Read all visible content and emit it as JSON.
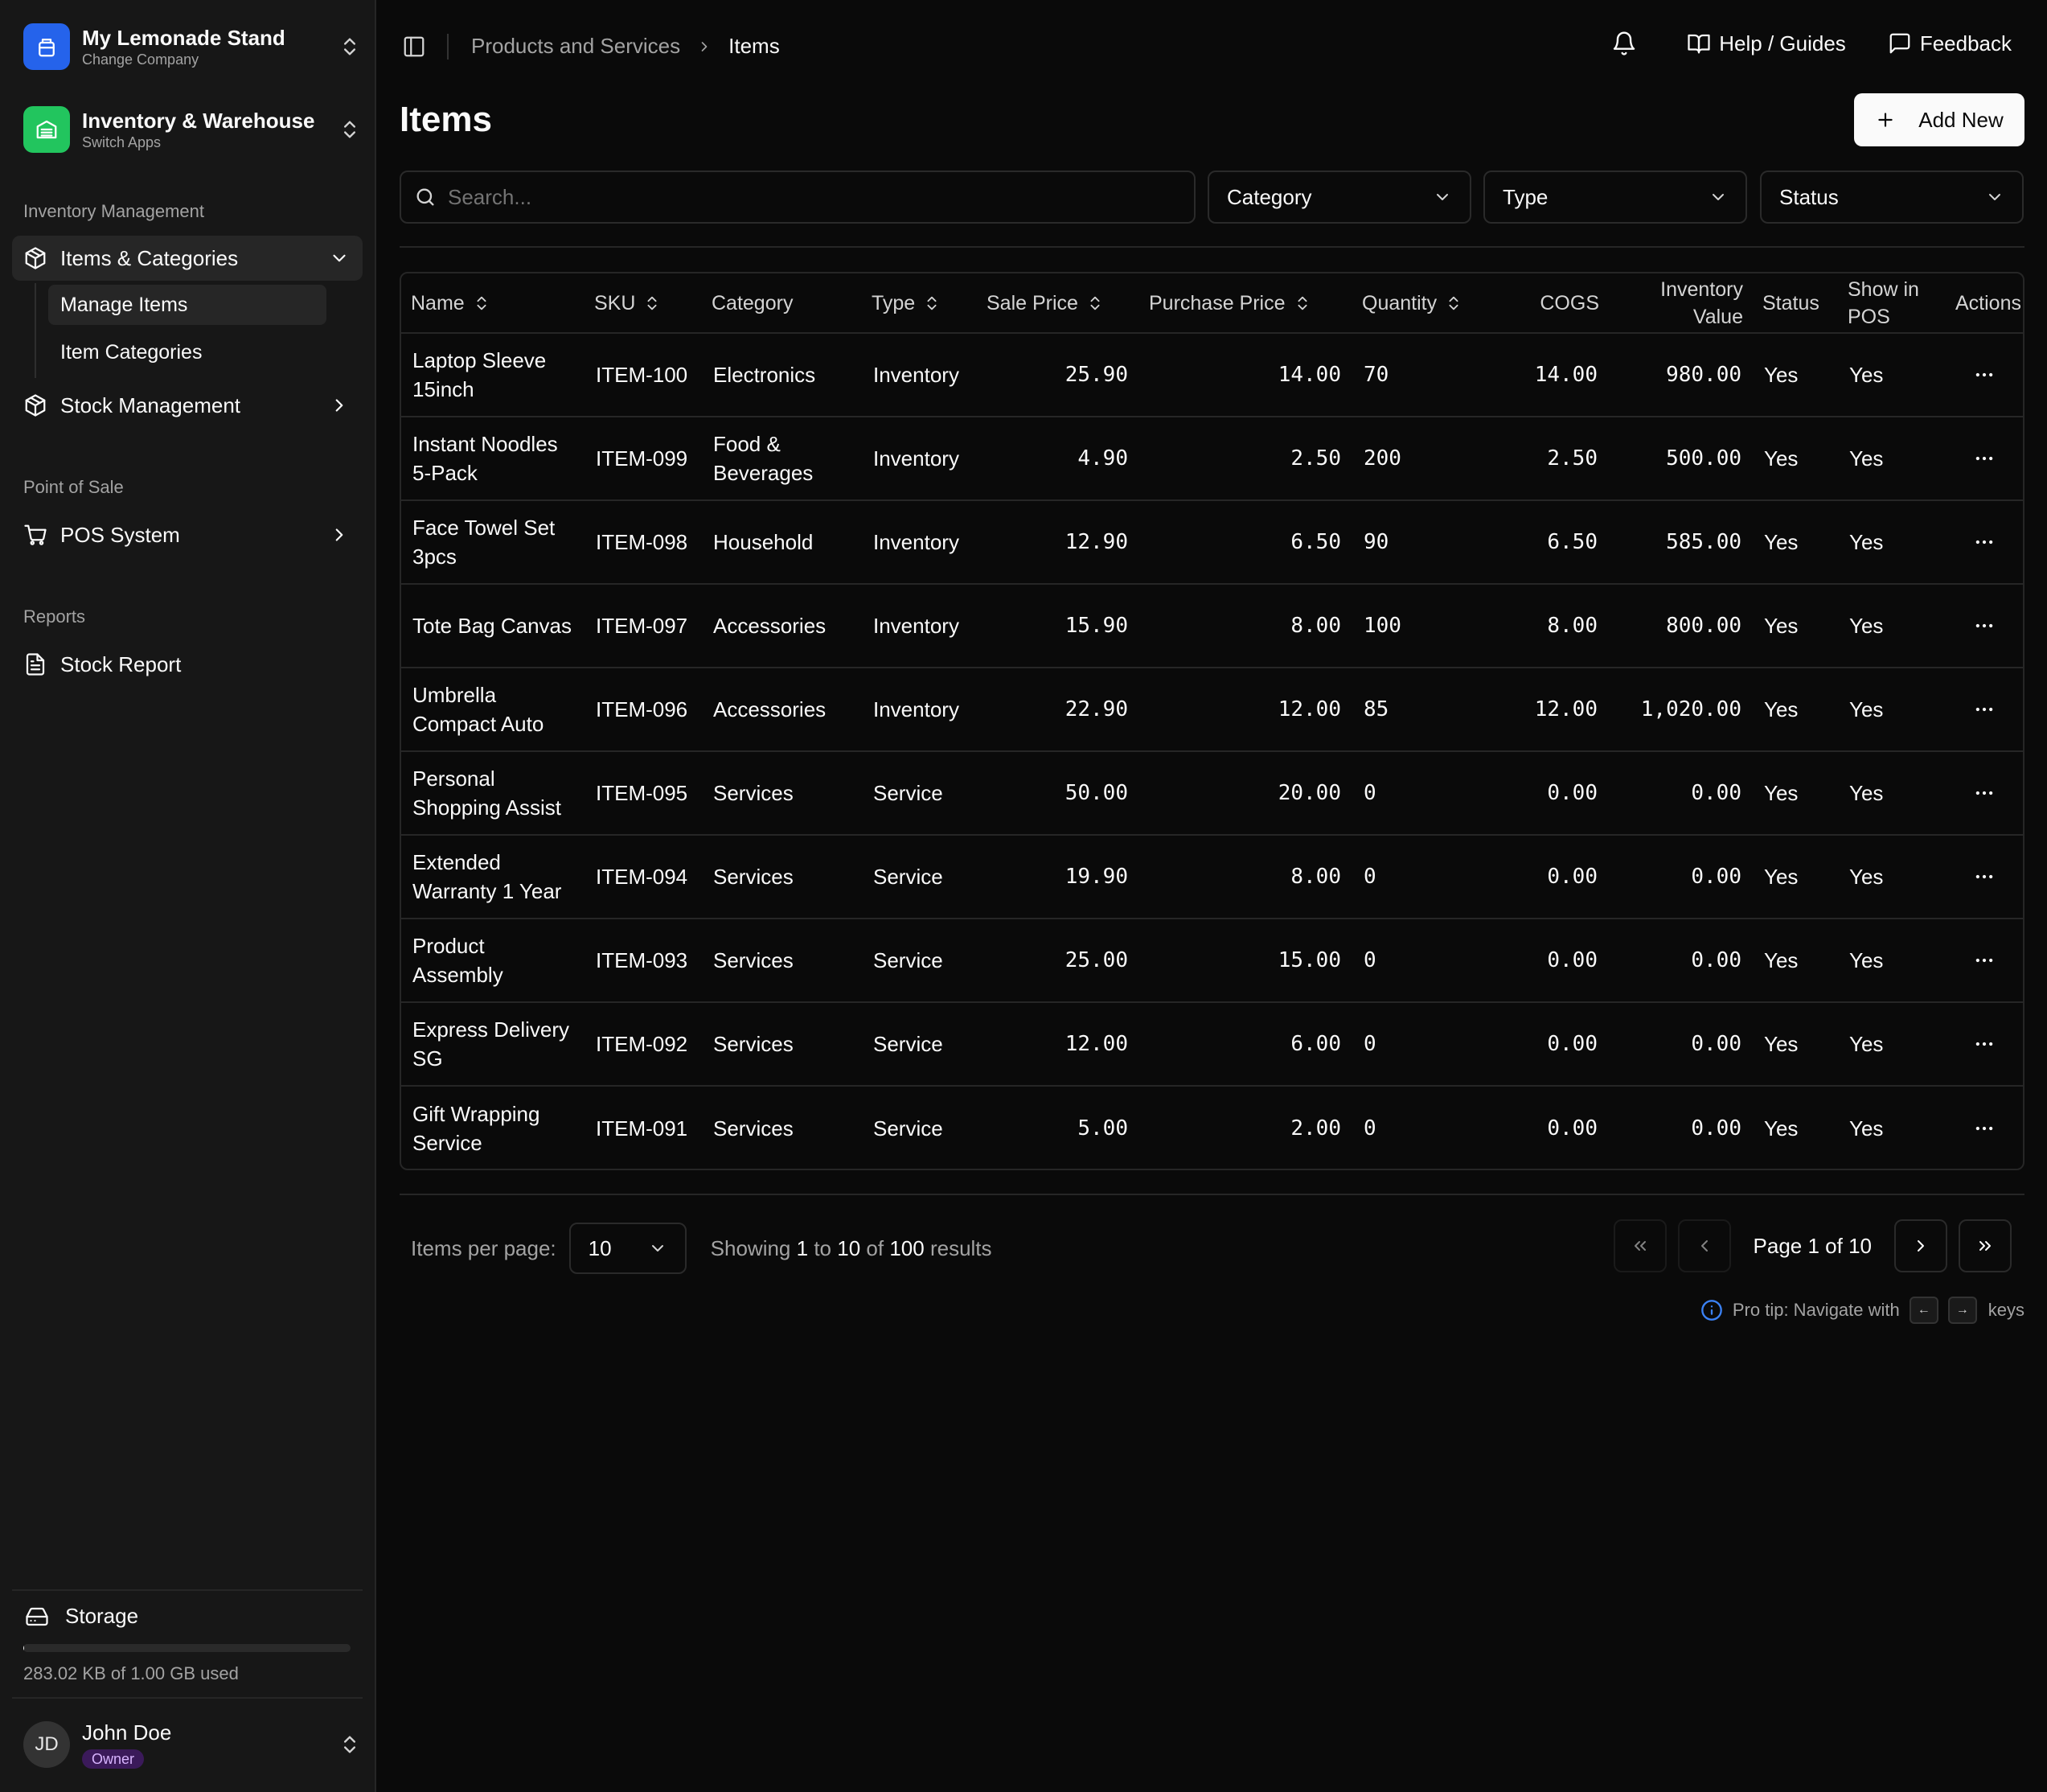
{
  "company": {
    "name": "My Lemonade Stand",
    "sub": "Change Company",
    "color": "#2563eb"
  },
  "app": {
    "name": "Inventory & Warehouse",
    "sub": "Switch Apps",
    "color": "#22c55e"
  },
  "sidebar": {
    "sections": [
      {
        "label": "Inventory Management"
      },
      {
        "label": "Point of Sale"
      },
      {
        "label": "Reports"
      }
    ],
    "items": [
      {
        "label": "Items & Categories",
        "icon": "box-icon"
      },
      {
        "label": "Stock Management",
        "icon": "box-icon"
      },
      {
        "label": "POS System",
        "icon": "cart-icon"
      },
      {
        "label": "Stock Report",
        "icon": "document-icon"
      }
    ],
    "sub_items": [
      {
        "label": "Manage Items"
      },
      {
        "label": "Item Categories"
      }
    ]
  },
  "storage": {
    "label": "Storage",
    "used_text": "283.02 KB of 1.00 GB used",
    "fraction_used": 0.0003
  },
  "user": {
    "name": "John Doe",
    "initials": "JD",
    "role": "Owner"
  },
  "breadcrumb": {
    "parent": "Products and Services",
    "current": "Items"
  },
  "top_actions": {
    "help": "Help / Guides",
    "feedback": "Feedback"
  },
  "page": {
    "title": "Items",
    "add_label": "Add New"
  },
  "filters": {
    "search_placeholder": "Search...",
    "category": "Category",
    "type": "Type",
    "status": "Status"
  },
  "table": {
    "columns": {
      "name": "Name",
      "sku": "SKU",
      "category": "Category",
      "type": "Type",
      "sale_price": "Sale Price",
      "purchase_price": "Purchase Price",
      "quantity": "Quantity",
      "cogs": "COGS",
      "inventory_value": "Inventory Value",
      "status": "Status",
      "show_in_pos": "Show in POS",
      "actions": "Actions"
    },
    "rows": [
      {
        "name": "Laptop Sleeve 15inch",
        "sku": "ITEM-100",
        "category": "Electronics",
        "type": "Inventory",
        "sale": "25.90",
        "purchase": "14.00",
        "qty": "70",
        "cogs": "14.00",
        "value": "980.00",
        "status": "Yes",
        "pos": "Yes"
      },
      {
        "name": "Instant Noodles 5-Pack",
        "sku": "ITEM-099",
        "category": "Food & Beverages",
        "type": "Inventory",
        "sale": "4.90",
        "purchase": "2.50",
        "qty": "200",
        "cogs": "2.50",
        "value": "500.00",
        "status": "Yes",
        "pos": "Yes"
      },
      {
        "name": "Face Towel Set 3pcs",
        "sku": "ITEM-098",
        "category": "Household",
        "type": "Inventory",
        "sale": "12.90",
        "purchase": "6.50",
        "qty": "90",
        "cogs": "6.50",
        "value": "585.00",
        "status": "Yes",
        "pos": "Yes"
      },
      {
        "name": "Tote Bag Canvas",
        "sku": "ITEM-097",
        "category": "Accessories",
        "type": "Inventory",
        "sale": "15.90",
        "purchase": "8.00",
        "qty": "100",
        "cogs": "8.00",
        "value": "800.00",
        "status": "Yes",
        "pos": "Yes"
      },
      {
        "name": "Umbrella Compact Auto",
        "sku": "ITEM-096",
        "category": "Accessories",
        "type": "Inventory",
        "sale": "22.90",
        "purchase": "12.00",
        "qty": "85",
        "cogs": "12.00",
        "value": "1,020.00",
        "status": "Yes",
        "pos": "Yes"
      },
      {
        "name": "Personal Shopping Assist",
        "sku": "ITEM-095",
        "category": "Services",
        "type": "Service",
        "sale": "50.00",
        "purchase": "20.00",
        "qty": "0",
        "cogs": "0.00",
        "value": "0.00",
        "status": "Yes",
        "pos": "Yes"
      },
      {
        "name": "Extended Warranty 1 Year",
        "sku": "ITEM-094",
        "category": "Services",
        "type": "Service",
        "sale": "19.90",
        "purchase": "8.00",
        "qty": "0",
        "cogs": "0.00",
        "value": "0.00",
        "status": "Yes",
        "pos": "Yes"
      },
      {
        "name": "Product Assembly",
        "sku": "ITEM-093",
        "category": "Services",
        "type": "Service",
        "sale": "25.00",
        "purchase": "15.00",
        "qty": "0",
        "cogs": "0.00",
        "value": "0.00",
        "status": "Yes",
        "pos": "Yes"
      },
      {
        "name": "Express Delivery SG",
        "sku": "ITEM-092",
        "category": "Services",
        "type": "Service",
        "sale": "12.00",
        "purchase": "6.00",
        "qty": "0",
        "cogs": "0.00",
        "value": "0.00",
        "status": "Yes",
        "pos": "Yes"
      },
      {
        "name": "Gift Wrapping Service",
        "sku": "ITEM-091",
        "category": "Services",
        "type": "Service",
        "sale": "5.00",
        "purchase": "2.00",
        "qty": "0",
        "cogs": "0.00",
        "value": "0.00",
        "status": "Yes",
        "pos": "Yes"
      }
    ]
  },
  "pagination": {
    "per_page_label": "Items per page:",
    "per_page": "10",
    "showing_prefix": "Showing",
    "from": "1",
    "to_word": "to",
    "to": "10",
    "of_word": "of",
    "total": "100",
    "results_word": "results",
    "page_text": "Page 1 of 10"
  },
  "tip": {
    "text": "Pro tip: Navigate with",
    "key_left": "←",
    "key_right": "→",
    "suffix": "keys"
  }
}
